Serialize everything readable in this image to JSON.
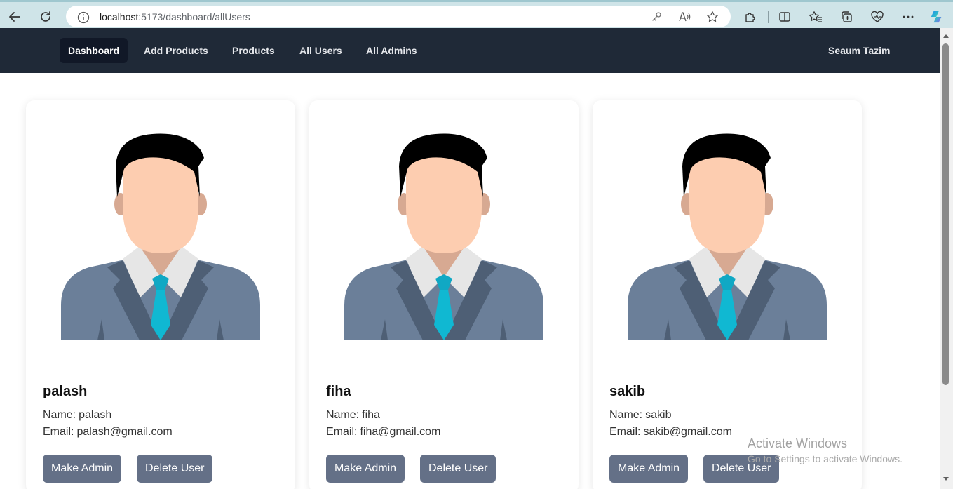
{
  "browser": {
    "url_host": "localhost",
    "url_path": ":5173/dashboard/allUsers",
    "icons": [
      "back-arrow-icon",
      "refresh-icon",
      "info-icon",
      "key-icon",
      "read-aloud-icon",
      "favorite-star-icon",
      "extensions-icon",
      "split-screen-icon",
      "favorites-icon",
      "collections-icon",
      "browser-essentials-icon",
      "more-icon",
      "copilot-icon"
    ]
  },
  "navbar": {
    "items": [
      {
        "label": "Dashboard",
        "active": true
      },
      {
        "label": "Add Products",
        "active": false
      },
      {
        "label": "Products",
        "active": false
      },
      {
        "label": "All Users",
        "active": false
      },
      {
        "label": "All Admins",
        "active": false
      }
    ],
    "user_name": "Seaum Tazim"
  },
  "users": [
    {
      "title": "palash",
      "name_label": "Name:",
      "name": "palash",
      "email_label": "Email:",
      "email": "palash@gmail.com",
      "make_admin_label": "Make Admin",
      "delete_label": "Delete User"
    },
    {
      "title": "fiha",
      "name_label": "Name:",
      "name": "fiha",
      "email_label": "Email:",
      "email": "fiha@gmail.com",
      "make_admin_label": "Make Admin",
      "delete_label": "Delete User"
    },
    {
      "title": "sakib",
      "name_label": "Name:",
      "name": "sakib",
      "email_label": "Email:",
      "email": "sakib@gmail.com",
      "make_admin_label": "Make Admin",
      "delete_label": "Delete User"
    }
  ],
  "watermark": {
    "title": "Activate Windows",
    "subtitle": "Go to Settings to activate Windows."
  },
  "colors": {
    "navbar_bg": "#1f2937",
    "button_bg": "#647087",
    "browser_bar": "#cfe4e8"
  }
}
